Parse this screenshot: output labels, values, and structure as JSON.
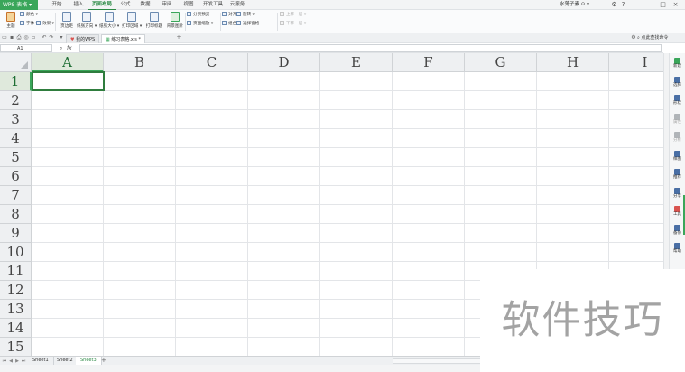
{
  "app": {
    "logo_label": "WPS 表格 ▾",
    "menu_tabs": [
      "开始",
      "插入",
      "页面布局",
      "公式",
      "数据",
      "审阅",
      "视图",
      "开发工具",
      "云服务"
    ],
    "active_tab": "页面布局",
    "user_label": "水薄子素 ⊙ ▾",
    "window_controls": [
      "⚙",
      "?",
      "–",
      "□",
      "×"
    ]
  },
  "ribbon": {
    "theme_group": {
      "theme": "主题",
      "colors": "颜色 ▾",
      "fonts": "字体 ▾",
      "effects": "效果 ▾"
    },
    "buttons": [
      "页边距",
      "纸张方向 ▾",
      "纸张大小 ▾",
      "打印区域 ▾",
      "打印标题",
      "背景图片"
    ],
    "page_breaks": "分页预览",
    "page_view": "页面缩放 ▾",
    "align": "对齐 ▾",
    "rotate": "旋转 ▾",
    "combine": "组合 ▾",
    "select_pane": "选择窗格",
    "bring_forward": "上移一层 ▾",
    "send_backward": "下移一层 ▾"
  },
  "doctabs": {
    "tabs": [
      "我的WPS",
      "练习表格.xls *"
    ],
    "active": "练习表格.xls *",
    "add": "+",
    "find_label": "点此查找命令"
  },
  "formula_bar": {
    "cell_ref": "A1",
    "fx": "fx",
    "value": ""
  },
  "grid": {
    "columns": [
      "A",
      "B",
      "C",
      "D",
      "E",
      "F",
      "G",
      "H",
      "I"
    ],
    "rows": [
      "1",
      "2",
      "3",
      "4",
      "5",
      "6",
      "7",
      "8",
      "9",
      "10",
      "11",
      "12",
      "13",
      "14",
      "15"
    ],
    "selected_cell": "A1"
  },
  "sidebar": {
    "items": [
      {
        "label": "新建",
        "icon": "new-icon",
        "color": "#3aa65a",
        "enabled": true
      },
      {
        "label": "选择",
        "icon": "select-icon",
        "color": "#4a6fa5",
        "enabled": true
      },
      {
        "label": "形状",
        "icon": "shape-icon",
        "color": "#4a6fa5",
        "enabled": true
      },
      {
        "label": "属性",
        "icon": "property-icon",
        "color": "#b0b4b8",
        "enabled": false
      },
      {
        "label": "分析",
        "icon": "analyze-icon",
        "color": "#b0b4b8",
        "enabled": false
      },
      {
        "label": "样图",
        "icon": "sample-icon",
        "color": "#4a6fa5",
        "enabled": true
      },
      {
        "label": "推荐",
        "icon": "recommend-icon",
        "color": "#4a6fa5",
        "enabled": true
      },
      {
        "label": "分享",
        "icon": "share-icon",
        "color": "#4a6fa5",
        "enabled": true
      },
      {
        "label": "工具",
        "icon": "tools-icon",
        "color": "#d9534f",
        "enabled": true
      },
      {
        "label": "备份",
        "icon": "backup-icon",
        "color": "#4a6fa5",
        "enabled": true
      },
      {
        "label": "帮助",
        "icon": "help-icon",
        "color": "#4a6fa5",
        "enabled": true
      }
    ]
  },
  "sheets": {
    "tabs": [
      "Sheet1",
      "Sheet2",
      "Sheet3"
    ],
    "active": "Sheet3",
    "add": "+"
  },
  "watermark": "软件技巧",
  "colors": {
    "accent": "#3aa65a",
    "selection": "#2f7d3e"
  }
}
